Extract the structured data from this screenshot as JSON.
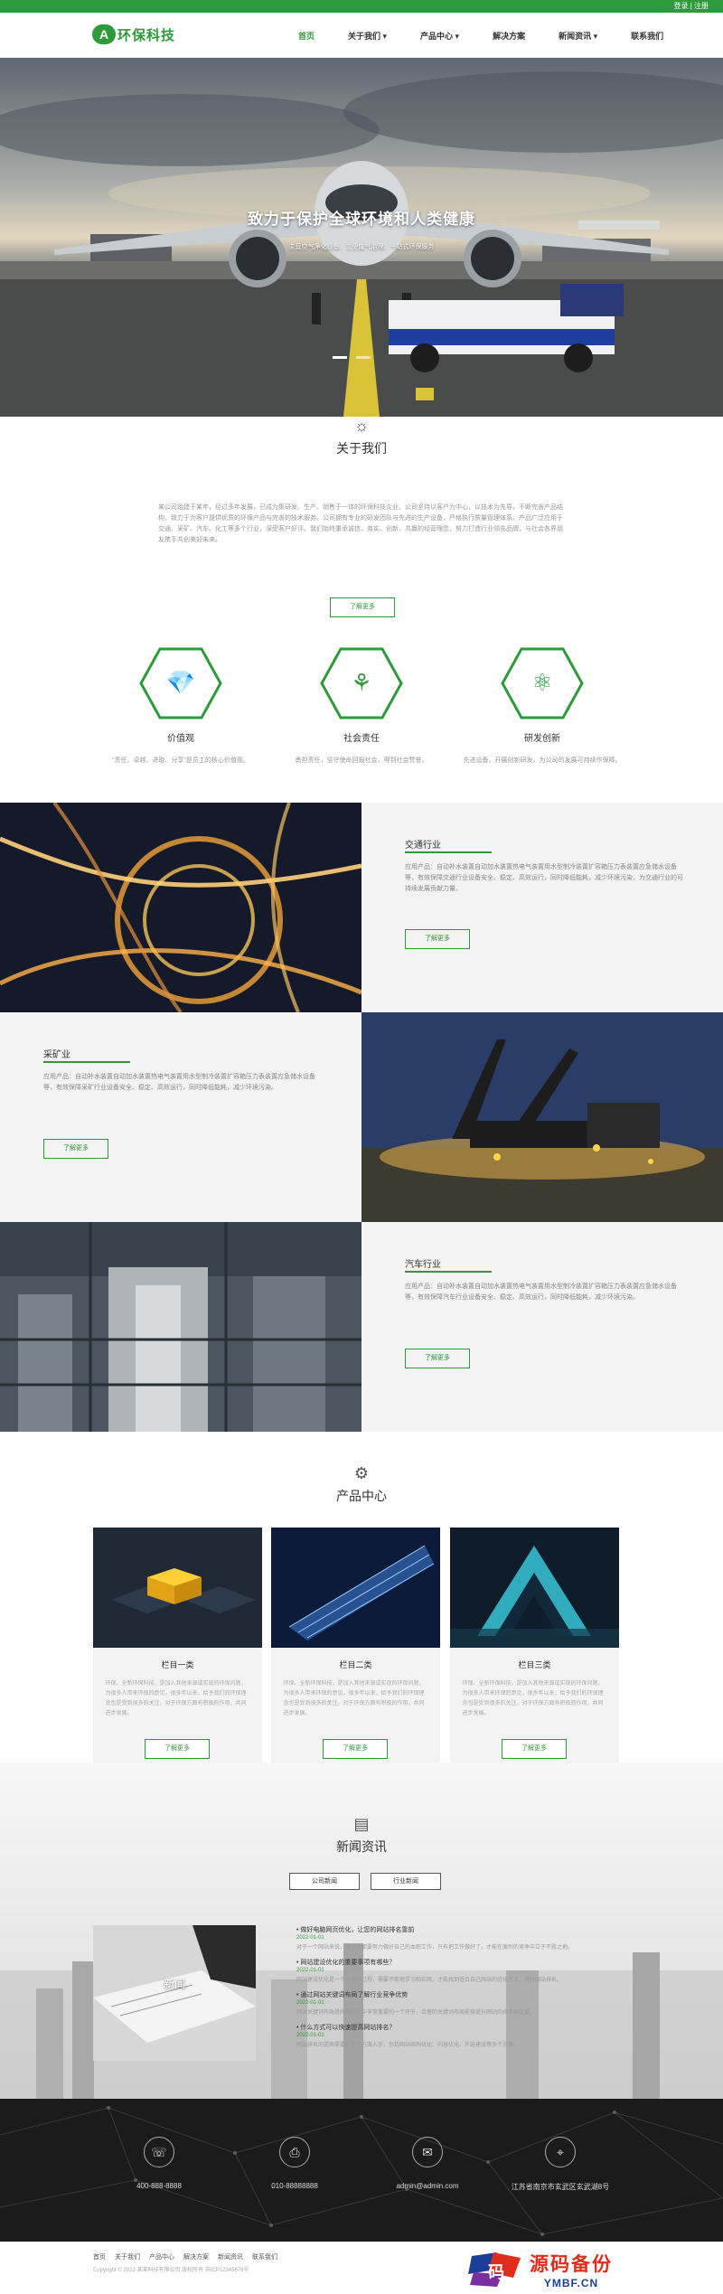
{
  "topbar": {
    "links": "登录 | 注册"
  },
  "header": {
    "logo_mark": "A",
    "logo_text": "环保科技",
    "nav": [
      {
        "label": "首页"
      },
      {
        "label": "关于我们 ▾"
      },
      {
        "label": "产品中心 ▾"
      },
      {
        "label": "解决方案"
      },
      {
        "label": "新闻资讯 ▾"
      },
      {
        "label": "联系我们"
      }
    ]
  },
  "hero": {
    "title": "致力于保护全球环境和人类健康",
    "subtitle": "主营空气净化设备、工业废气治理、一站式环保服务"
  },
  "about": {
    "icon": "lightbulb-icon",
    "title": "关于我们",
    "text": "某公司始建于某年，经过多年发展，已成为集研发、生产、销售于一体的环保科技企业。公司坚持以客户为中心，以技术为先导，不断完善产品结构，致力于为客户提供优质的环保产品与完善的技术服务。公司拥有专业的研发团队与先进的生产设备，严格执行质量管理体系，产品广泛应用于交通、采矿、汽车、化工等多个行业，深受客户好评。我们始终秉承诚信、务实、创新、共赢的经营理念，努力打造行业领先品牌，与社会各界朋友携手共创美好未来。",
    "button": "了解更多"
  },
  "values": [
    {
      "icon": "diamond-icon",
      "glyph": "💎",
      "title": "价值观",
      "desc": "“责任、卓越、进取、分享”是员工的核心价值观。"
    },
    {
      "icon": "social-responsibility-icon",
      "glyph": "⚘",
      "title": "社会责任",
      "desc": "勇担责任，坚守使命回报社会，得到社会赞誉。"
    },
    {
      "icon": "atom-icon",
      "glyph": "⚛",
      "title": "研发创新",
      "desc": "先进设备，开展创新研发，为公司的发展可持续作保障。"
    }
  ],
  "industries": [
    {
      "title": "交通行业",
      "text": "应用产品：自动补水装置自动加水装置热电气装置用水型制冷装置扩容箱压力表装置应急储水设备等，有效保障交通行业设备安全、稳定、高效运行，同时降低能耗，减少环境污染，为交通行业的可持续发展贡献力量。",
      "button": "了解更多"
    },
    {
      "title": "采矿业",
      "text": "应用产品：自动补水装置自动加水装置热电气装置用水型制冷装置扩容箱压力表装置应急储水设备等，有效保障采矿行业设备安全、稳定、高效运行，同时降低能耗，减少环境污染。",
      "button": "了解更多"
    },
    {
      "title": "汽车行业",
      "text": "应用产品：自动补水装置自动加水装置热电气装置用水型制冷装置扩容箱压力表装置应急储水设备等，有效保障汽车行业设备安全、稳定、高效运行，同时降低能耗，减少环境污染。",
      "button": "了解更多"
    }
  ],
  "products": {
    "icon": "gears-icon",
    "title": "产品中心",
    "items": [
      {
        "title": "栏目一类",
        "desc": "环保、全新环保科技，是加入其他来源或实现的环保问题，为很多人带来环保的意见，很多年以来，给予我们的环保理念也是受到很多的关注，对于环保方面有积极的作用，共同进步发展。",
        "button": "了解更多"
      },
      {
        "title": "栏目二类",
        "desc": "环保、全新环保科技，是加入其他来源或实现的环保问题，为很多人带来环保的意见，很多年以来，给予我们的环保理念也是受到很多的关注，对于环保方面有积极的作用，共同进步发展。",
        "button": "了解更多"
      },
      {
        "title": "栏目三类",
        "desc": "环保、全新环保科技，是加入其他来源或实现的环保问题，为很多人带来环保的意见，很多年以来，给予我们的环保理念也是受到很多的关注，对于环保方面有积极的作用，共同进步发展。",
        "button": "了解更多"
      }
    ]
  },
  "news": {
    "icon": "newspaper-icon",
    "title": "新闻资讯",
    "tabs": [
      "公司新闻",
      "行业新闻"
    ],
    "image_caption": "新闻",
    "items": [
      {
        "title": "做好电脑网页优化，让您的网站排名靠前",
        "date": "2022-01-01",
        "summary": "对于一个网站来说，每个人都要努力做好自己的本职工作，只有把工作做好了，才能在激烈的竞争中立于不败之地。"
      },
      {
        "title": "网站建设优化的重要事项有哪些？",
        "date": "2022-01-01",
        "summary": "网站建设优化是一个长期的过程，需要不断地学习和实践，才能找到适合自己网站的优化方法，提升网站排名。"
      },
      {
        "title": "通过网站关键词布局了解行业竞争优势",
        "date": "2022-01-01",
        "summary": "网站关键词布局是网站优化中非常重要的一个环节，合理的关键词布局能够提升网站的排名和流量。"
      },
      {
        "title": "什么方式可以快速提高网站排名？",
        "date": "2022-01-01",
        "summary": "网站排名的提高需要从多个方面入手，包括网站结构优化、内容优化、外链建设等多个方面。"
      }
    ]
  },
  "contact": [
    {
      "icon": "phone-icon",
      "glyph": "☏",
      "text": "400-888-8888"
    },
    {
      "icon": "printer-icon",
      "glyph": "⎙",
      "text": "010-88888888"
    },
    {
      "icon": "mail-icon",
      "glyph": "✉",
      "text": "admin@admin.com"
    },
    {
      "icon": "location-icon",
      "glyph": "⌖",
      "text": "江苏省南京市玄武区玄武湖8号"
    }
  ],
  "footer": {
    "nav": [
      "首页",
      "关于我们",
      "产品中心",
      "解决方案",
      "新闻资讯",
      "联系我们"
    ],
    "copyright": "Copyright © 2022 某某科技有限公司 版权所有 苏ICP12345678号"
  },
  "watermark": {
    "line1": "源码备份",
    "line2": "YMBF.CN"
  },
  "colors": {
    "brand": "#2e9b3a",
    "dark": "#1b1b1b"
  }
}
